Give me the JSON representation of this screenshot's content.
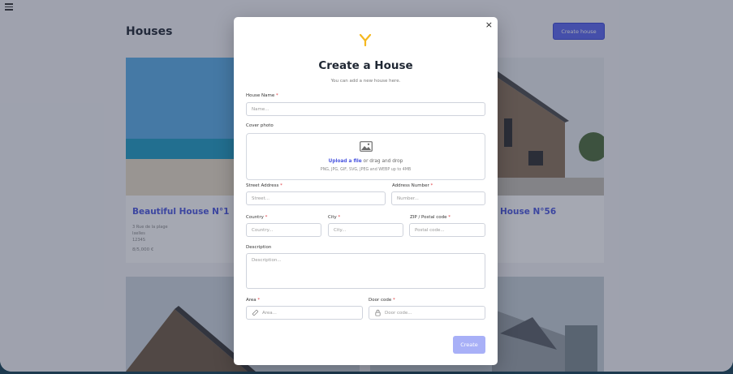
{
  "page": {
    "title": "Houses",
    "create_button": "Create house"
  },
  "cards": [
    {
      "title": "Beautiful House N°1",
      "address": "3 Rue de la plage",
      "city": "Ixelles",
      "zip": "1234S",
      "price": "8/5,000 €"
    },
    {
      "title": "House N°56"
    }
  ],
  "modal": {
    "close": "×",
    "logo": "Y",
    "title": "Create a House",
    "subtitle": "You can add a new house here.",
    "house_name": {
      "label": "House Name",
      "placeholder": "Name..."
    },
    "cover_photo": {
      "label": "Cover photo",
      "link": "Upload a file",
      "rest": " or drag and drop",
      "hint": "PNG, JPG, GIF, SVG, JPEG and WEBP up to 4MB"
    },
    "street": {
      "label": "Street Address",
      "placeholder": "Street..."
    },
    "number": {
      "label": "Address Number",
      "placeholder": "Number..."
    },
    "country": {
      "label": "Country",
      "placeholder": "Country..."
    },
    "city": {
      "label": "City",
      "placeholder": "City..."
    },
    "zip": {
      "label": "ZIP / Postal code",
      "placeholder": "Postal code..."
    },
    "description": {
      "label": "Description",
      "placeholder": "Description..."
    },
    "area": {
      "label": "Area",
      "placeholder": "Area...",
      "icon": "ruler-icon"
    },
    "door_code": {
      "label": "Door code",
      "placeholder": "Door code...",
      "icon": "lock-icon"
    },
    "required_mark": "*",
    "submit": "Create"
  },
  "colors": {
    "accent": "#5b67f2",
    "accent_disabled": "#a8b0f7",
    "logo": "#f5b820",
    "required": "#e0383e"
  }
}
